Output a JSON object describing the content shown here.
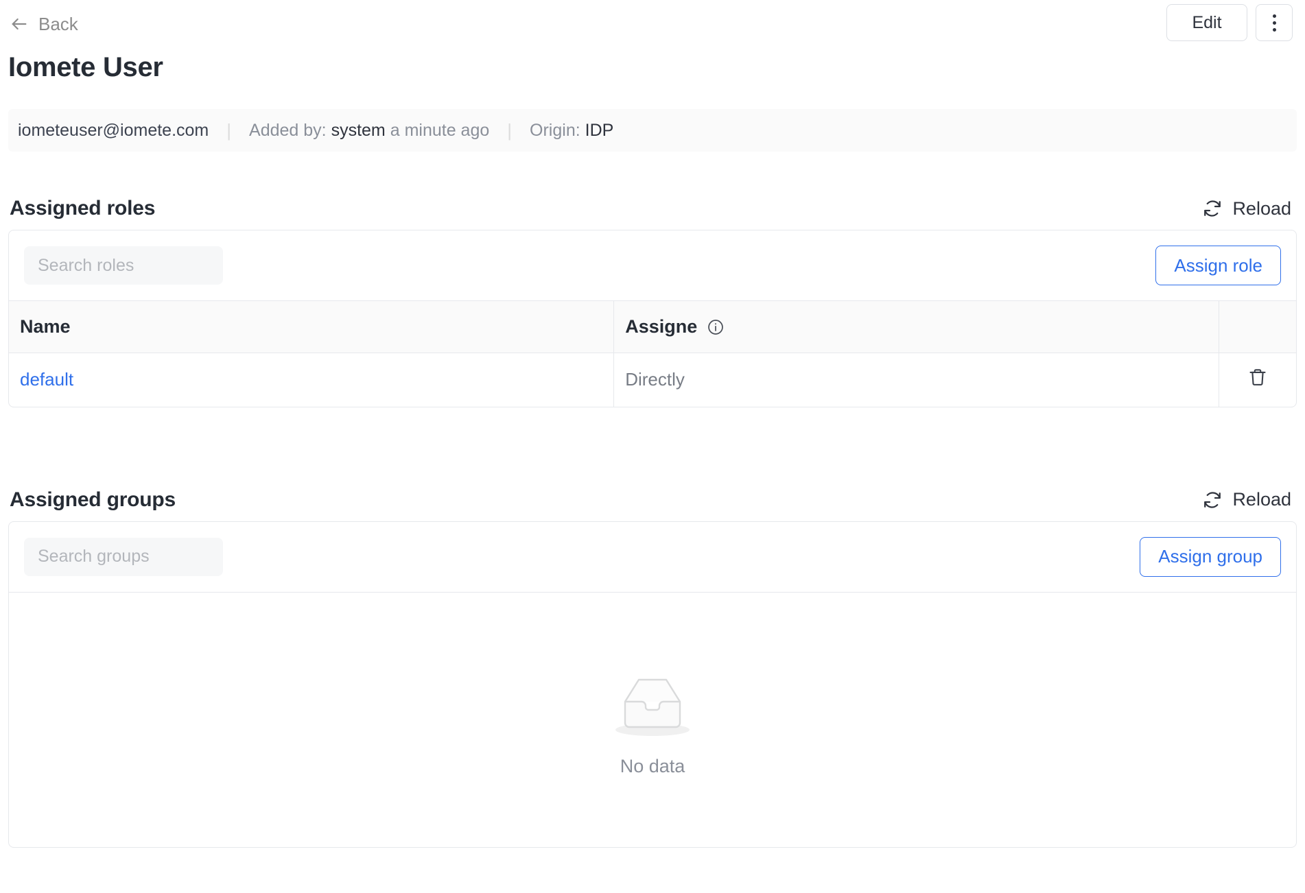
{
  "topbar": {
    "back_label": "Back",
    "back_icon": "arrow-left-icon",
    "edit_label": "Edit",
    "more_icon": "more-vertical-icon"
  },
  "page_title": "Iomete User",
  "meta": {
    "email": "iometeuser@iomete.com",
    "added_by_label": "Added by:",
    "added_by_value": "system",
    "added_when": "a minute ago",
    "origin_label": "Origin:",
    "origin_value": "IDP",
    "separator": "|"
  },
  "roles_section": {
    "title": "Assigned roles",
    "reload_label": "Reload",
    "reload_icon": "refresh-icon",
    "search_placeholder": "Search roles",
    "search_value": "",
    "assign_label": "Assign role",
    "columns": [
      "Name",
      "Assigne",
      ""
    ],
    "info_icon": "info-circle-icon",
    "delete_icon": "trash-icon",
    "rows": [
      {
        "name": "default",
        "assigned": "Directly"
      }
    ]
  },
  "groups_section": {
    "title": "Assigned groups",
    "reload_label": "Reload",
    "reload_icon": "refresh-icon",
    "search_placeholder": "Search groups",
    "search_value": "",
    "assign_label": "Assign group",
    "empty_icon": "empty-inbox-icon",
    "empty_text": "No data"
  },
  "colors": {
    "accent_blue": "#2f6fea",
    "text_dark": "#262c35",
    "text_muted": "#8a8f99",
    "border": "#e6e8ec",
    "surface_grey": "#fafafa"
  }
}
